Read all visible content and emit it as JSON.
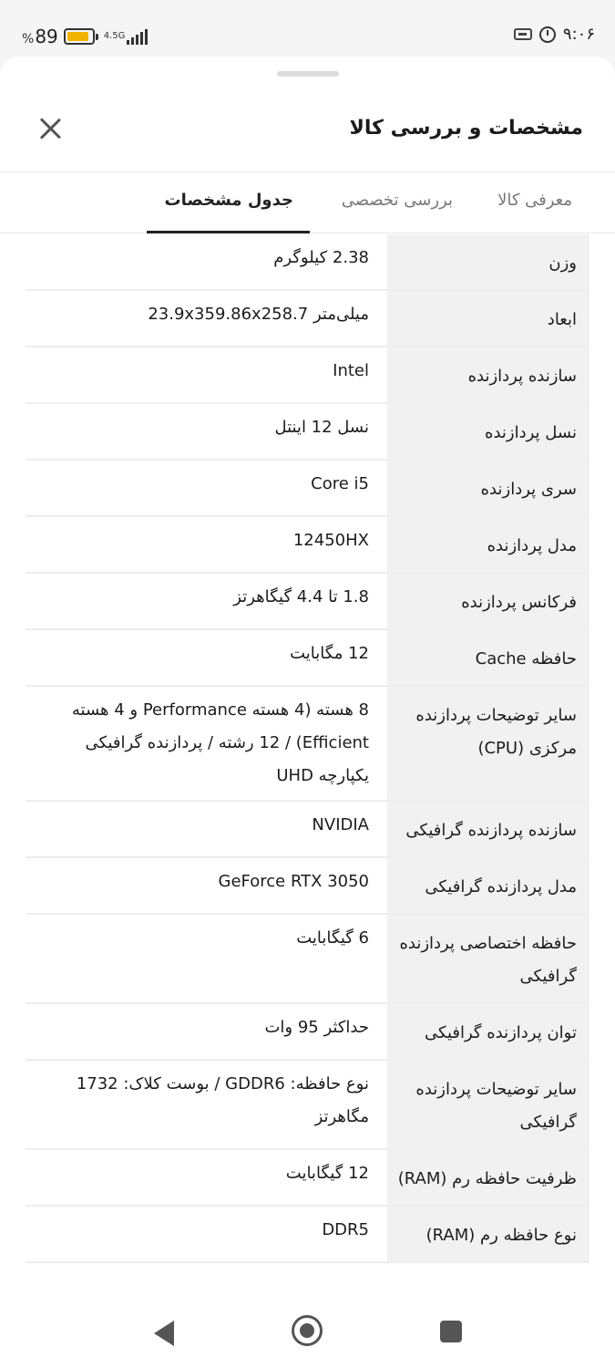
{
  "status_bar": {
    "battery_percent_sign": "%",
    "battery_value": "89",
    "battery_level": 0.89,
    "network_type": "4.5G",
    "time": "۹:۰۶"
  },
  "header": {
    "title": "مشخصات و بررسی کالا"
  },
  "tabs": [
    {
      "label": "معرفی کالا"
    },
    {
      "label": "بررسی تخصصی"
    },
    {
      "label": "جدول مشخصات",
      "active": true
    }
  ],
  "specs": [
    {
      "label": "وزن",
      "value": "2.38 کیلوگرم"
    },
    {
      "label": "ابعاد",
      "value": "میلی‌متر 23.9x359.86x258.7"
    },
    {
      "label": "سازنده پردازنده",
      "value": "Intel"
    },
    {
      "label": "نسل پردازنده",
      "value": "نسل 12 اینتل"
    },
    {
      "label": "سری پردازنده",
      "value": "Core i5"
    },
    {
      "label": "مدل پردازنده",
      "value": "12450HX"
    },
    {
      "label": "فرکانس پردازنده",
      "value": "1.8 تا 4.4 گیگاهرتز"
    },
    {
      "label": "حافظه Cache",
      "value": "12 مگابایت"
    },
    {
      "label": "سایر توضیحات پردازنده مرکزی (CPU)",
      "value": "8 هسته (4 هسته Performance و 4 هسته Efficient) / 12 رشته / پردازنده گرافیکی یکپارچه UHD"
    },
    {
      "label": "سازنده پردازنده گرافیکی",
      "value": "NVIDIA"
    },
    {
      "label": "مدل پردازنده گرافیکی",
      "value": "GeForce RTX 3050"
    },
    {
      "label": "حافظه اختصاصی پردازنده گرافیکی",
      "value": "6 گیگابایت"
    },
    {
      "label": "توان پردازنده گرافیکی",
      "value": "حداکثر 95 وات"
    },
    {
      "label": "سایر توضیحات پردازنده گرافیکی",
      "value": "نوع حافظه: GDDR6 / بوست کلاک: 1732 مگاهرتز"
    },
    {
      "label": "ظرفیت حافظه رم (RAM)",
      "value": "12 گیگابایت"
    },
    {
      "label": "نوع حافظه رم (RAM)",
      "value": "DDR5"
    }
  ],
  "colors": {
    "label_bg": "#f1f1f1",
    "divider": "#eeeeee",
    "battery_fill": "#f2b300",
    "text": "#1c1c1c"
  }
}
